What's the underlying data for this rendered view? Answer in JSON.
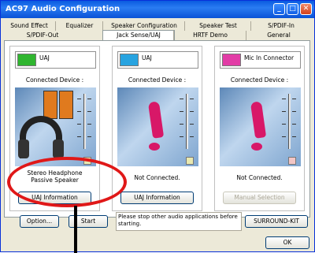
{
  "window": {
    "title": "AC97 Audio Configuration"
  },
  "tabs": {
    "row1": [
      "Sound Effect",
      "Equalizer",
      "Speaker Configuration",
      "Speaker Test",
      "S/PDIF-In"
    ],
    "row2": [
      "S/PDIF-Out",
      "Jack Sense/UAJ",
      "HRTF Demo",
      "General"
    ],
    "active": "Jack Sense/UAJ"
  },
  "groups": [
    {
      "jack_label": "UAJ",
      "device_label": "Connected Device :",
      "status": "Stereo Headphone\nPassive Speaker",
      "button": "UAJ Information",
      "button_enabled": true,
      "jack_color": "#2fb52f"
    },
    {
      "jack_label": "UAJ",
      "device_label": "Connected Device :",
      "status": "Not Connected.",
      "button": "UAJ Information",
      "button_enabled": true,
      "jack_color": "#27a3e0"
    },
    {
      "jack_label": "Mic In Connector",
      "device_label": "Connected Device :",
      "status": "Not Connected.",
      "button": "Manual Selection",
      "button_enabled": false,
      "jack_color": "#e23ca6"
    }
  ],
  "bottom": {
    "option_button": "Option...",
    "start_button": "Start",
    "message": "Please stop other audio applications before starting.",
    "surround_button": "SURROUND-KIT",
    "ok_button": "OK"
  }
}
